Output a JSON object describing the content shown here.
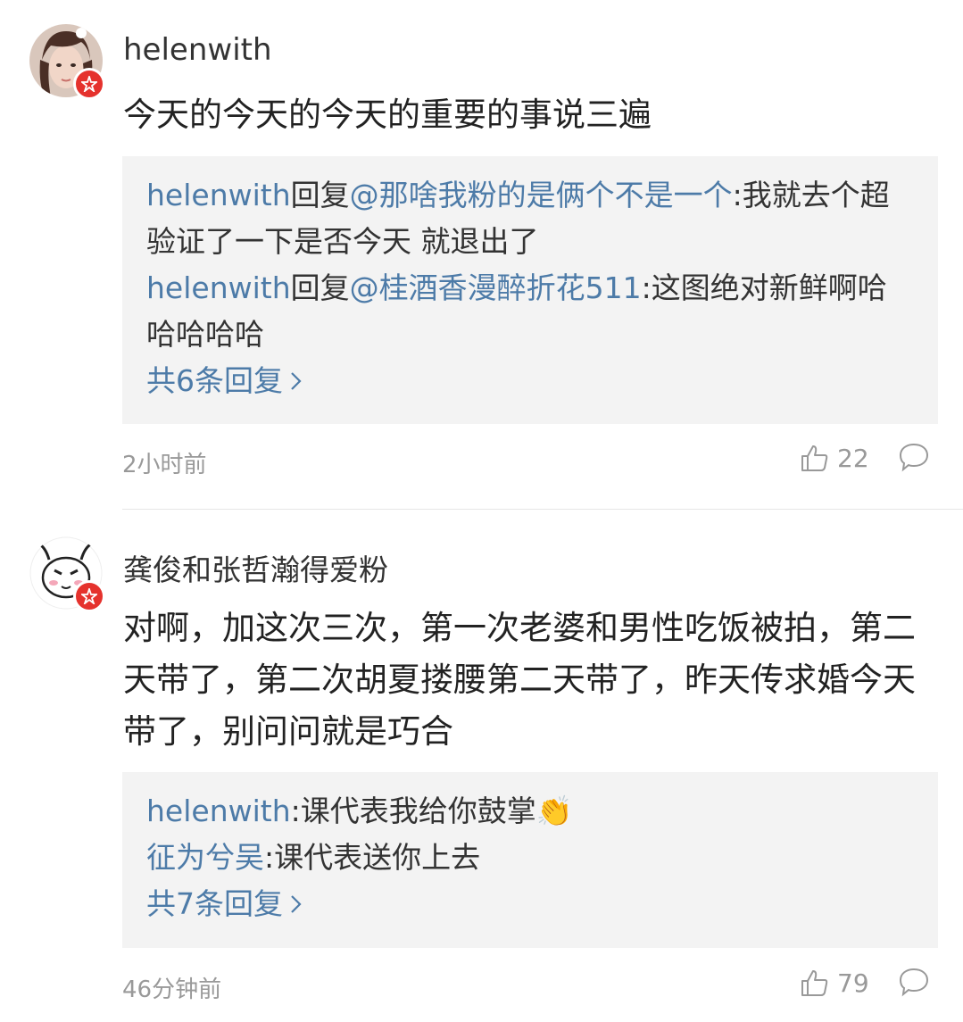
{
  "comments": [
    {
      "username": "helenwith",
      "text": "今天的今天的今天的重要的事说三遍",
      "replies": [
        {
          "user": "helenwith",
          "content_prefix": "回复",
          "mention": "@那啥我粉的是俩个不是一个",
          "content": ":我就去个超验证了一下是否今天 就退出了"
        },
        {
          "user": "helenwith",
          "content_prefix": "回复",
          "mention": "@桂酒香漫醉折花511",
          "content": ":这图绝对新鲜啊哈哈哈哈哈"
        }
      ],
      "more_replies": "共6条回复",
      "time": "2小时前",
      "likes": "22"
    },
    {
      "username": "龚俊和张哲瀚得爱粉",
      "text": "对啊，加这次三次，第一次老婆和男性吃饭被拍，第二天带了，第二次胡夏搂腰第二天带了，昨天传求婚今天带了，别问问就是巧合",
      "replies": [
        {
          "user": "helenwith",
          "content": ":课代表我给你鼓掌👏"
        },
        {
          "user": "征为兮吴",
          "content": ":课代表送你上去"
        }
      ],
      "more_replies": "共7条回复",
      "time": "46分钟前",
      "likes": "79"
    }
  ],
  "icons": {
    "like": "thumbs-up-icon",
    "reply": "speech-bubble-icon",
    "badge": "verified-badge-icon",
    "more": "chevron-right-icon"
  },
  "colors": {
    "link": "#4d7ba8",
    "badge": "#e5322d",
    "reply_bg": "#f3f3f3",
    "meta": "#999999"
  }
}
